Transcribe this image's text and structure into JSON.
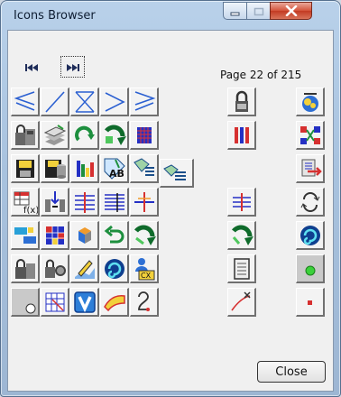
{
  "window": {
    "title": "Icons Browser"
  },
  "navigation": {
    "first_icon": "first-page-icon",
    "next_icon": "last-page-icon",
    "page_label": "Page 22 of 215"
  },
  "footer": {
    "close_label": "Close"
  },
  "icons": [
    "chevron-less-icon",
    "diagonal-line-icon",
    "crossed-chevrons-icon",
    "chevron-greater-icon",
    "chevron-greater-equal-icon",
    "padlock-machine-icon",
    "rotate-mechanism-icon",
    "padlock-part-icon",
    "layers-stack-icon",
    "rotate-arrow-icon",
    "green-rotate-icon",
    "blue-grid-icon",
    "red-blue-bars-icon",
    "connector-nodes-icon",
    "floppy-save-icon",
    "floppy-database-icon",
    "color-bars-icon",
    "tag-text-icon",
    "tag-lines-icon",
    "tag-lines-small-icon",
    "red-arrow-export-icon",
    "table-function-icon",
    "split-arrow-icon",
    "multi-line-align-icon",
    "line-align-icon",
    "cross-align-icon",
    "horizontal-align-icon",
    "cycle-arrows-icon",
    "blue-join-icon",
    "color-grid-icon",
    "cube-explode-icon",
    "undo-loop-icon",
    "green-loop-icon",
    "green-undo-icon",
    "blue-spiral-icon",
    "lock-part-gear-icon",
    "gear-padlock-icon",
    "pen-shape-icon",
    "blue-spiral-small-icon",
    "person-export-icon",
    "document-panel-icon",
    "green-dot-icon",
    "white-dot-icon",
    "grid-select-icon",
    "v-badge-icon",
    "surface-patch-icon",
    "s-curve-icon",
    "red-x-curve-icon",
    "red-dot-icon"
  ]
}
